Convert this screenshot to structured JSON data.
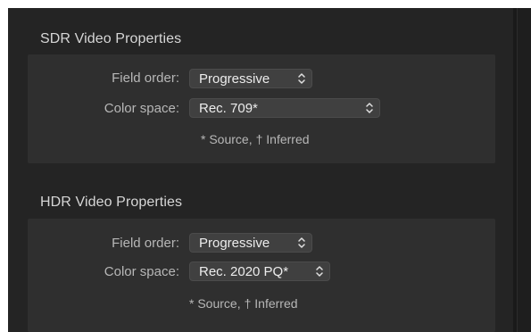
{
  "sdr": {
    "title": "SDR Video Properties",
    "field_order": {
      "label": "Field order:",
      "value": "Progressive"
    },
    "color_space": {
      "label": "Color space:",
      "value": "Rec. 709*"
    },
    "note": {
      "source": "* Source,",
      "inferred": "† Inferred"
    }
  },
  "hdr": {
    "title": "HDR Video Properties",
    "field_order": {
      "label": "Field order:",
      "value": "Progressive"
    },
    "color_space": {
      "label": "Color space:",
      "value": "Rec. 2020 PQ*"
    },
    "note": {
      "source": "* Source,",
      "inferred": "† Inferred"
    }
  },
  "icons": {
    "popup_indicator": "chevron-up-down-icon"
  },
  "colors": {
    "background": "#242424",
    "panel": "#2f2f2f",
    "popup": "#404040",
    "text_primary": "#ececec",
    "text_secondary": "#b7b7b7"
  }
}
